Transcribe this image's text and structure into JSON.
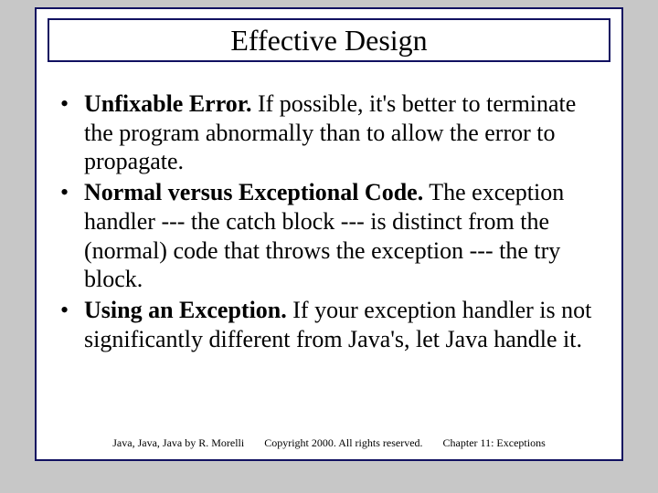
{
  "title": "Effective Design",
  "bullets": [
    {
      "bold": "Unfixable Error.",
      "rest": " If possible, it's better to terminate the program abnormally than to allow the error to propagate."
    },
    {
      "bold": "Normal versus Exceptional Code.",
      "rest": " The exception handler --- the catch block --- is distinct from the (normal) code that throws the exception --- the try block."
    },
    {
      "bold": "Using an Exception.",
      "rest": " If your exception handler is not significantly different from Java's, let Java handle it."
    }
  ],
  "footer": {
    "left": "Java, Java, Java by R. Morelli",
    "center": "Copyright 2000. All rights reserved.",
    "right": "Chapter 11: Exceptions"
  }
}
